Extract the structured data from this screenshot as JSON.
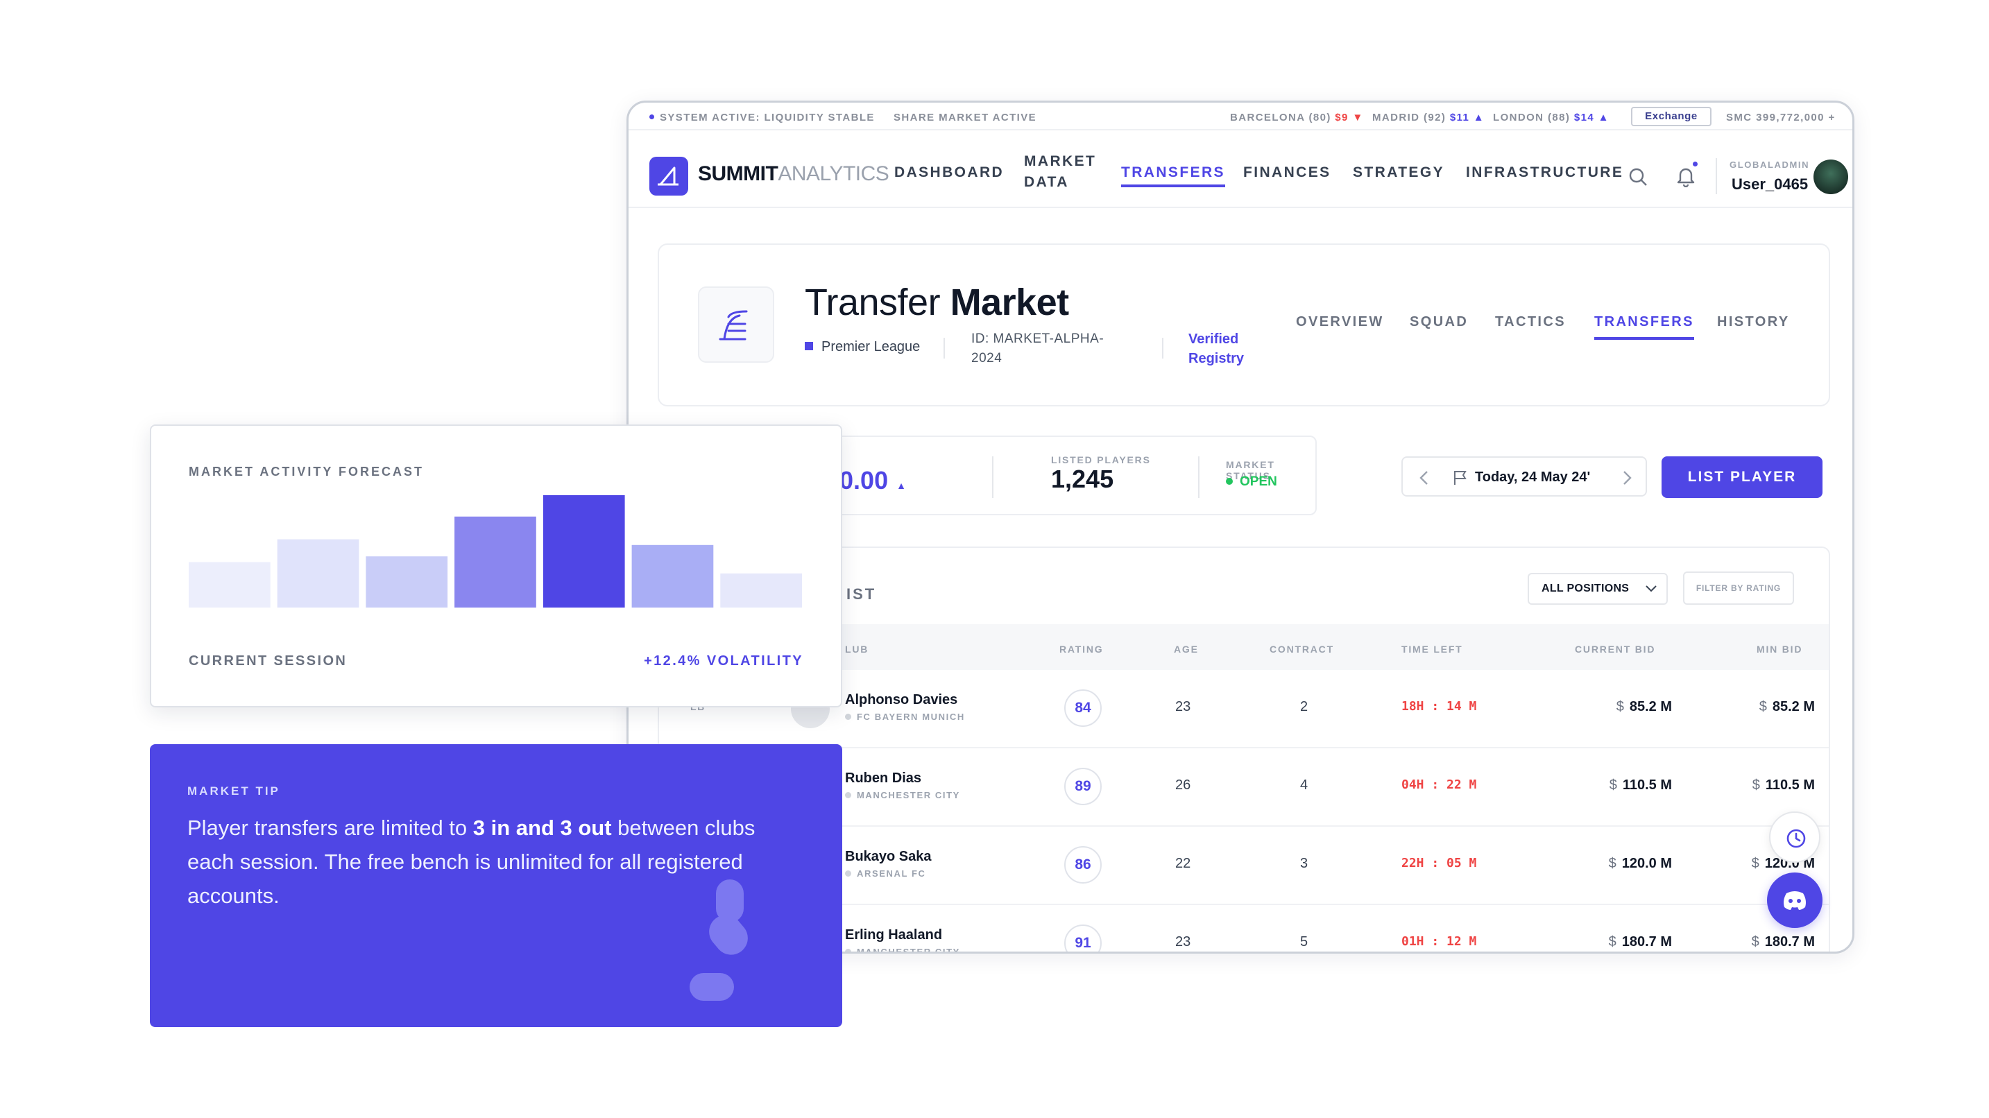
{
  "ticker": {
    "system": "SYSTEM ACTIVE: LIQUIDITY STABLE",
    "share": "SHARE MARKET ACTIVE",
    "barcelona": "BARCELONA (80)",
    "barcelona_price": "$9",
    "madrid": "MADRID (92)",
    "madrid_price": "$11",
    "london": "LONDON (88)",
    "london_price": "$14",
    "exchange_button": "Exchange",
    "smc": "SMC 399,772,000 +"
  },
  "nav": {
    "brand_bold": "SUMMIT",
    "brand_light": "ANALYTICS",
    "items": [
      "DASHBOARD",
      "MARKET DATA",
      "TRANSFERS",
      "FINANCES",
      "STRATEGY",
      "INFRASTRUCTURE"
    ],
    "active_item": "TRANSFERS",
    "role": "GLOBALADMIN",
    "username": "User_0465"
  },
  "header": {
    "title_light": "Transfer",
    "title_bold": "Market",
    "league": "Premier League",
    "market_id": "ID: MARKET-ALPHA-2024",
    "verified": "Verified Registry",
    "subtabs": [
      "OVERVIEW",
      "SQUAD",
      "TACTICS",
      "TRANSFERS",
      "HISTORY"
    ],
    "active_subtab": "TRANSFERS"
  },
  "stats": {
    "price": "00.00",
    "listed_label": "LISTED PLAYERS",
    "listed_value": "1,245",
    "status_label": "MARKET STATUS",
    "status_value": "OPEN",
    "date": "Today, 24 May 24'",
    "list_button": "LIST PLAYER"
  },
  "table": {
    "title_fragment": "IST",
    "position_filter": "ALL POSITIONS",
    "rating_filter": "FILTER BY RATING",
    "columns": [
      "LUB",
      "RATING",
      "AGE",
      "CONTRACT",
      "TIME LEFT",
      "CURRENT BID",
      "MIN BID"
    ],
    "rows": [
      {
        "pos": "LB",
        "name": "Alphonso Davies",
        "club": "FC BAYERN MUNICH",
        "rating": "84",
        "age": "23",
        "contract": "2",
        "time_left": "18H : 14 M",
        "current_bid": "85.2 M",
        "min_bid": "85.2 M"
      },
      {
        "pos": "",
        "name": "Ruben Dias",
        "club": "MANCHESTER CITY",
        "rating": "89",
        "age": "26",
        "contract": "4",
        "time_left": "04H : 22 M",
        "current_bid": "110.5 M",
        "min_bid": "110.5 M"
      },
      {
        "pos": "",
        "name": "Bukayo Saka",
        "club": "ARSENAL FC",
        "rating": "86",
        "age": "22",
        "contract": "3",
        "time_left": "22H : 05 M",
        "current_bid": "120.0 M",
        "min_bid": "120.0 M"
      },
      {
        "pos": "",
        "name": "Erling Haaland",
        "club": "MANCHESTER CITY",
        "rating": "91",
        "age": "23",
        "contract": "5",
        "time_left": "01H : 12 M",
        "current_bid": "180.7 M",
        "min_bid": "180.7 M"
      }
    ],
    "currency": "$"
  },
  "forecast": {
    "title": "MARKET ACTIVITY FORECAST",
    "left_label": "CURRENT SESSION",
    "right_label": "+12.4% VOLATILITY"
  },
  "chart_data": {
    "type": "bar",
    "title": "MARKET ACTIVITY FORECAST",
    "categories": [
      "1",
      "2",
      "3",
      "4",
      "5",
      "6",
      "7"
    ],
    "values": [
      40,
      60,
      45,
      80,
      100,
      55,
      30
    ],
    "ylim": [
      0,
      100
    ],
    "bar_colors": [
      "#eceefc",
      "#e0e3fb",
      "#c9cdf8",
      "#8a86ef",
      "#4f46e5",
      "#a9aef5",
      "#e6e8fb"
    ],
    "grid": false,
    "axes_visible": false
  },
  "tip": {
    "label": "MARKET TIP",
    "text_before": "Player transfers are limited to ",
    "text_bold": "3 in and 3 out",
    "text_after": " between clubs each session. The free bench is unlimited for all registered accounts."
  },
  "colors": {
    "accent": "#4f46e5",
    "danger": "#ef4444",
    "success": "#22c55e"
  }
}
